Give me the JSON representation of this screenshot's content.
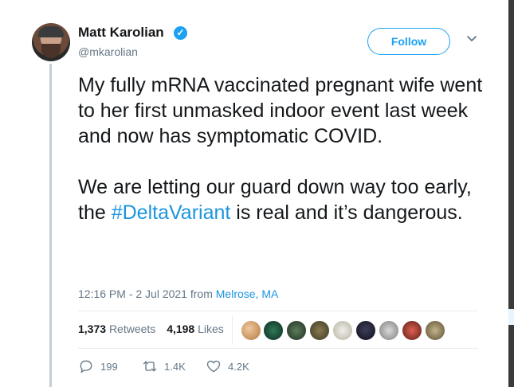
{
  "tweet": {
    "author_name": "Matt Karolian",
    "handle": "@mkarolian",
    "follow_label": "Follow",
    "text_part1": "My fully mRNA vaccinated pregnant wife went to her first unmasked indoor event last week and now has symptomatic COVID.\n\nWe are letting our guard down way too early, the ",
    "hashtag": "#DeltaVariant",
    "text_part2": " is real and it’s dangerous.",
    "timestamp": "12:16 PM - 2 Jul 2021",
    "from_label": "from",
    "location": "Melrose, MA",
    "retweets_count": "1,373",
    "retweets_label": "Retweets",
    "likes_count": "4,198",
    "likes_label": "Likes",
    "replies": "199",
    "retweets_short": "1.4K",
    "likes_short": "4.2K"
  },
  "icons": {
    "verified": "verified-badge-icon",
    "chevron": "chevron-down-icon",
    "reply": "reply-icon",
    "retweet": "retweet-icon",
    "like": "heart-icon"
  },
  "colors": {
    "accent": "#1da1f2",
    "link": "#1b95e0",
    "text": "#14171a",
    "muted": "#657786"
  }
}
